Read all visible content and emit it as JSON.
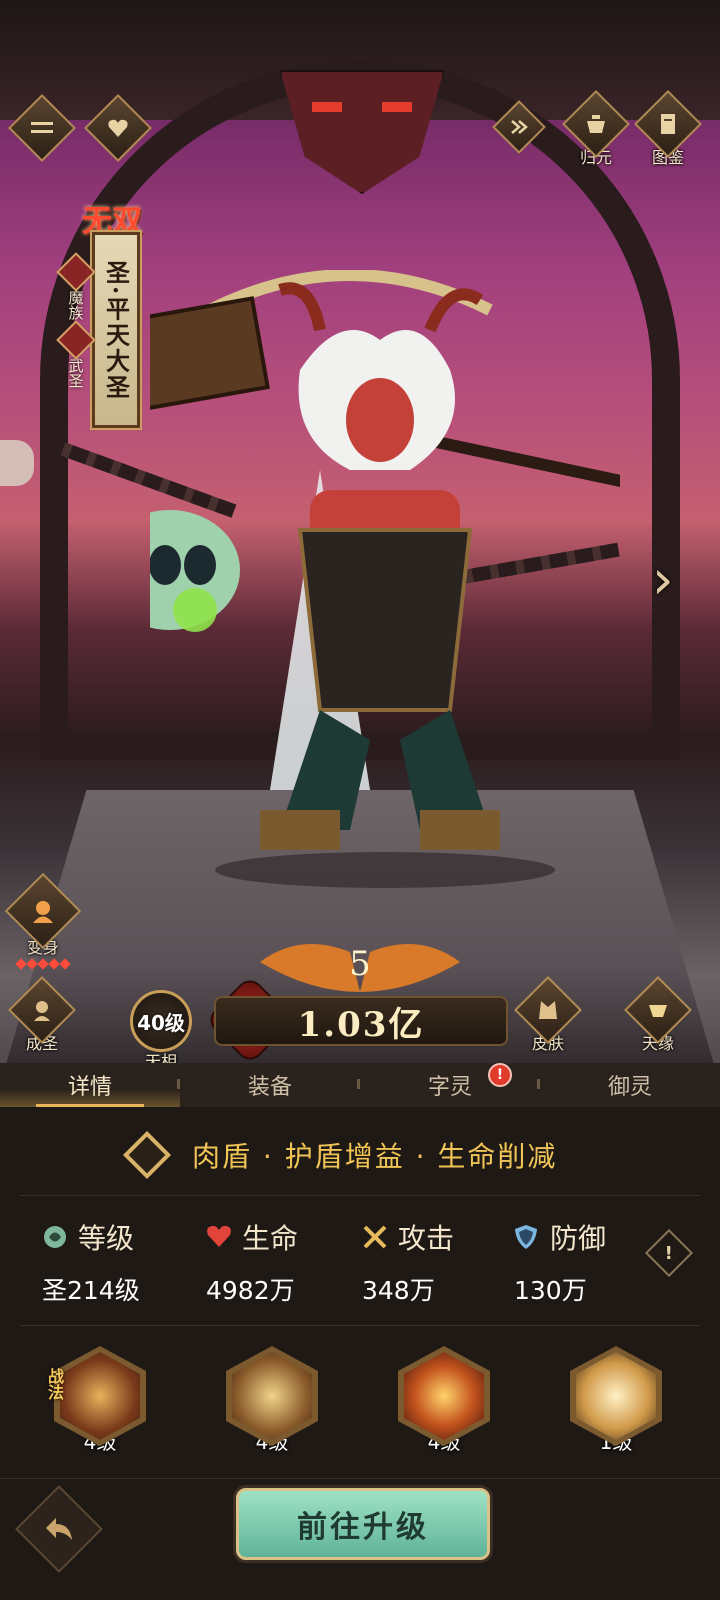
{
  "top_left": {
    "menu_icon": "menu-icon",
    "favorite_icon": "heart-icon"
  },
  "top_right": {
    "skip_icon": "skip-icon",
    "guiyuan_label": "归元",
    "tujian_label": "图鉴"
  },
  "hero": {
    "rank_badge": "无双",
    "name": "圣·平天大圣",
    "tags": [
      "魔族",
      "武圣"
    ],
    "star_count": 5,
    "level_label": "5"
  },
  "left_actions": {
    "bianshen_label": "变身",
    "chengsheng_label": "成圣",
    "tianxiang_level": "40级",
    "tianxiang_label": "天相"
  },
  "right_actions": {
    "pifu_label": "皮肤",
    "tianyuan_label": "天缘"
  },
  "power": {
    "value": "1.03亿"
  },
  "tabs": [
    {
      "label": "详情",
      "active": true
    },
    {
      "label": "装备",
      "active": false
    },
    {
      "label": "字灵",
      "active": false,
      "alert": "!"
    },
    {
      "label": "御灵",
      "active": false
    }
  ],
  "role": {
    "text": "肉盾 · 护盾增益 · 生命削减"
  },
  "stats": [
    {
      "icon": "level-icon",
      "label": "等级",
      "value": "圣214级",
      "color": "#7fb79a"
    },
    {
      "icon": "heart-icon",
      "label": "生命",
      "value": "4982万",
      "color": "#e0443a"
    },
    {
      "icon": "swords-icon",
      "label": "攻击",
      "value": "348万",
      "color": "#e6b95a"
    },
    {
      "icon": "shield-icon",
      "label": "防御",
      "value": "130万",
      "color": "#7ab6e0"
    }
  ],
  "skills": {
    "tag": "战法",
    "items": [
      {
        "level": "4级",
        "icon": "bull-skill-icon"
      },
      {
        "level": "4级",
        "icon": "warrior-skill-icon"
      },
      {
        "level": "4级",
        "icon": "fire-ring-skill-icon"
      },
      {
        "level": "1级",
        "icon": "silhouette-skill-icon"
      }
    ]
  },
  "footer": {
    "upgrade_label": "前往升级",
    "back_icon": "back-arrow-icon"
  },
  "colors": {
    "accent_gold": "#e8b55a",
    "role_text": "#f0c455",
    "upgrade_button": "#7cc9ad",
    "alert_red": "#e03b2b"
  }
}
